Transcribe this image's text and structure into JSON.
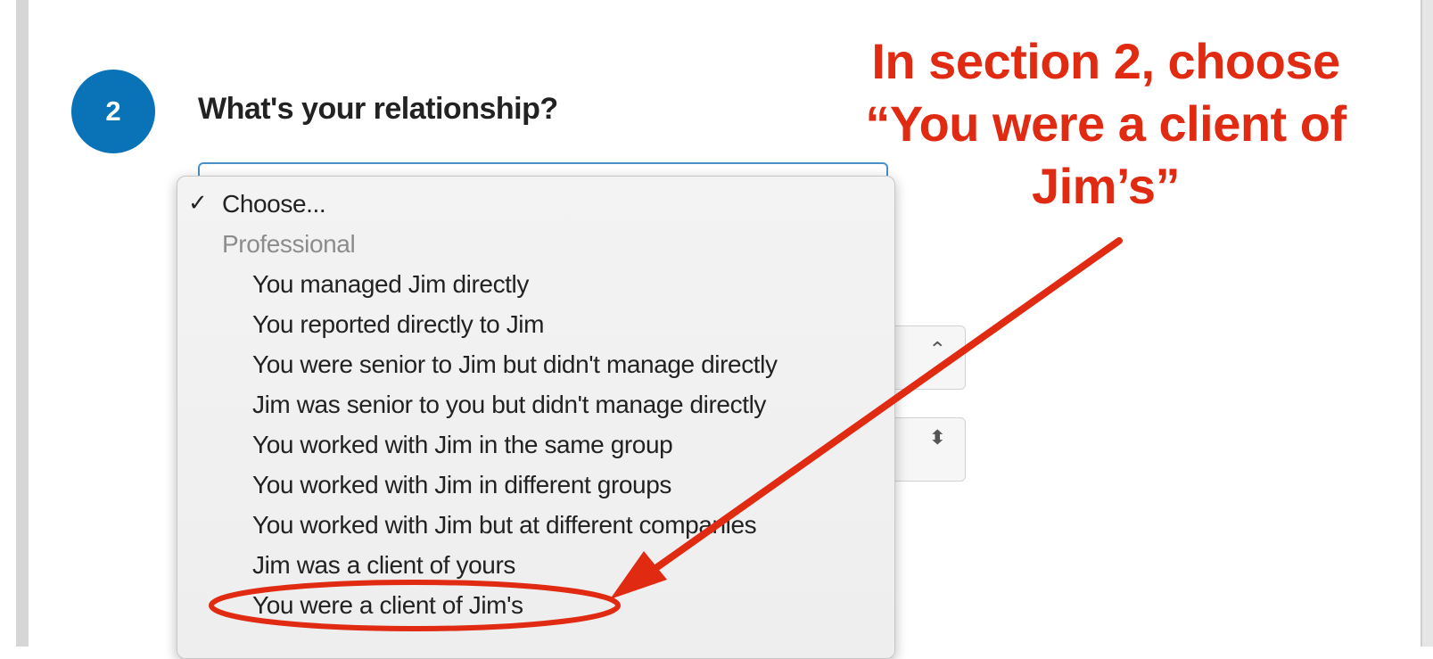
{
  "question": {
    "step_number": "2",
    "label": "What's your relationship?"
  },
  "dropdown": {
    "selected_checkmark": "✓",
    "selected": "Choose...",
    "group_label": "Professional",
    "options": [
      "You managed Jim directly",
      "You reported directly to Jim",
      "You were senior to Jim but didn't manage directly",
      "Jim was senior to you but didn't manage directly",
      "You worked with Jim in the same group",
      "You worked with Jim in different groups",
      "You worked with Jim but at different companies",
      "Jim was a client of yours",
      "You were a client of Jim's"
    ]
  },
  "annotation": {
    "text_line1": "In section 2, choose",
    "text_line2": "“You were a client of",
    "text_line3": "Jim’s”",
    "color": "#e02a12",
    "highlighted_option": "You were a client of Jim's"
  },
  "colors": {
    "step_circle": "#0a73b7",
    "select_focus_border": "#4a90c8"
  },
  "icons": {
    "select_arrows": "up-down-chevron-icon"
  }
}
